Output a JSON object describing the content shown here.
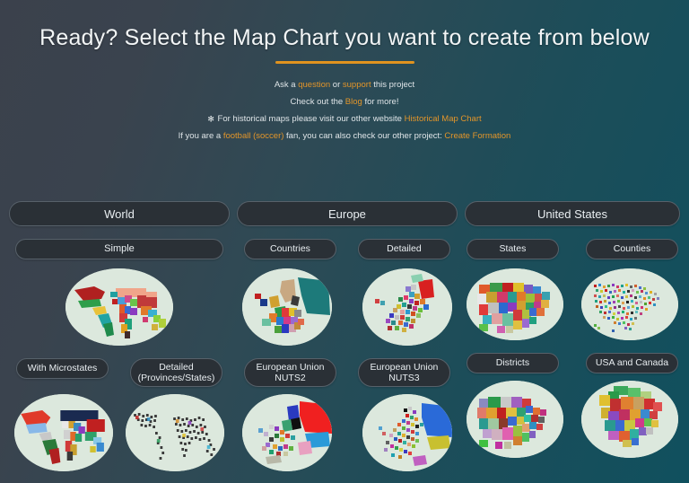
{
  "header": {
    "title": "Ready? Select the Map Chart you want to create from below"
  },
  "intro": {
    "line1": {
      "pre": "Ask a ",
      "link1": "question",
      "mid": " or ",
      "link2": "support",
      "post": " this project"
    },
    "line2": {
      "pre": "Check out the ",
      "link1": "Blog",
      "post": " for more!"
    },
    "line3": {
      "icon": "star-icon",
      "glyph": "✻",
      "pre": " For historical maps please visit our other website ",
      "link1": "Historical Map Chart"
    },
    "line4": {
      "pre": "If you are a ",
      "link1": "football (soccer)",
      "mid": " fan, you can also check our other project: ",
      "link2": "Create Formation"
    }
  },
  "columns": [
    {
      "id": "world",
      "section_label": "World",
      "rows": [
        {
          "buttons": [
            {
              "label": "Simple",
              "style": "wide"
            }
          ],
          "thumbs": [
            {
              "name": "world-simple-map",
              "kind": "world-simple"
            }
          ]
        },
        {
          "buttons": [
            {
              "label": "With Microstates",
              "style": "half"
            },
            {
              "label": "Detailed\n(Provinces/States)",
              "style": "half-tall"
            }
          ],
          "thumbs": [
            {
              "name": "world-microstates-map",
              "kind": "world-micro"
            },
            {
              "name": "world-detailed-map",
              "kind": "world-detailed"
            }
          ]
        }
      ]
    },
    {
      "id": "europe",
      "section_label": "Europe",
      "rows": [
        {
          "buttons": [
            {
              "label": "Countries",
              "style": "half"
            },
            {
              "label": "Detailed",
              "style": "half"
            }
          ],
          "thumbs": [
            {
              "name": "europe-countries-map",
              "kind": "eu-countries"
            },
            {
              "name": "europe-detailed-map",
              "kind": "eu-detailed"
            }
          ]
        },
        {
          "buttons": [
            {
              "label": "European Union\nNUTS2",
              "style": "half-tall"
            },
            {
              "label": "European Union\nNUTS3",
              "style": "half-tall"
            }
          ],
          "thumbs": [
            {
              "name": "europe-nuts2-map",
              "kind": "eu-nuts2"
            },
            {
              "name": "europe-nuts3-map",
              "kind": "eu-nuts3"
            }
          ]
        }
      ]
    },
    {
      "id": "united-states",
      "section_label": "United States",
      "rows": [
        {
          "buttons": [
            {
              "label": "States",
              "style": "half"
            },
            {
              "label": "Counties",
              "style": "half"
            }
          ],
          "thumbs": [
            {
              "name": "us-states-map",
              "kind": "us-states"
            },
            {
              "name": "us-counties-map",
              "kind": "us-counties"
            }
          ]
        },
        {
          "buttons": [
            {
              "label": "Districts",
              "style": "half"
            },
            {
              "label": "USA and Canada",
              "style": "half"
            }
          ],
          "thumbs": [
            {
              "name": "us-districts-map",
              "kind": "us-districts"
            },
            {
              "name": "usa-canada-map",
              "kind": "usa-canada"
            }
          ]
        }
      ]
    }
  ],
  "colors": {
    "background_left": "#3b414c",
    "background_right": "#10505e",
    "accent_underline": "#e0931f",
    "link": "#e2952a",
    "button_fill": "#2a3036",
    "button_border": "#57616a",
    "thumb_bg": "#dce8dd",
    "text": "#e8ecef"
  }
}
